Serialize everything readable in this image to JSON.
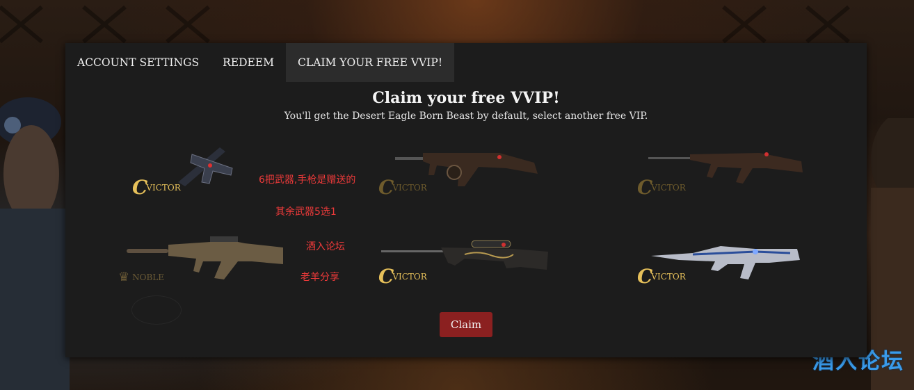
{
  "tabs": [
    {
      "label": "ACCOUNT SETTINGS",
      "active": false
    },
    {
      "label": "REDEEM",
      "active": false
    },
    {
      "label": "CLAIM YOUR FREE VVIP!",
      "active": true
    }
  ],
  "main": {
    "heading": "Claim your free VVIP!",
    "subheading": "You'll get the Desert Eagle Born Beast by default, select another free VIP.",
    "claim_label": "Claim"
  },
  "items": [
    {
      "badge": "VICTOR",
      "weapon": "desert-eagle-icon",
      "selected": true
    },
    {
      "badge": "VICTOR",
      "weapon": "thompson-icon",
      "selected": false
    },
    {
      "badge": "VICTOR",
      "weapon": "ak47-icon",
      "selected": false
    },
    {
      "badge": "NOBLE",
      "weapon": "m4a1-icon",
      "selected": false
    },
    {
      "badge": "VICTOR",
      "weapon": "sniper-rifle-icon",
      "selected": false
    },
    {
      "badge": "VICTOR",
      "weapon": "futuristic-rifle-icon",
      "selected": false
    }
  ],
  "notes": [
    "6把武器,手枪是赠送的",
    "其余武器5选1",
    "酒入论坛",
    "老羊分享"
  ],
  "watermark": "酒入论坛",
  "colors": {
    "accent": "#8b2020",
    "victor_gold": "#e6c05a",
    "note_red": "#ee3a3a",
    "watermark_blue": "#3a9bea"
  }
}
